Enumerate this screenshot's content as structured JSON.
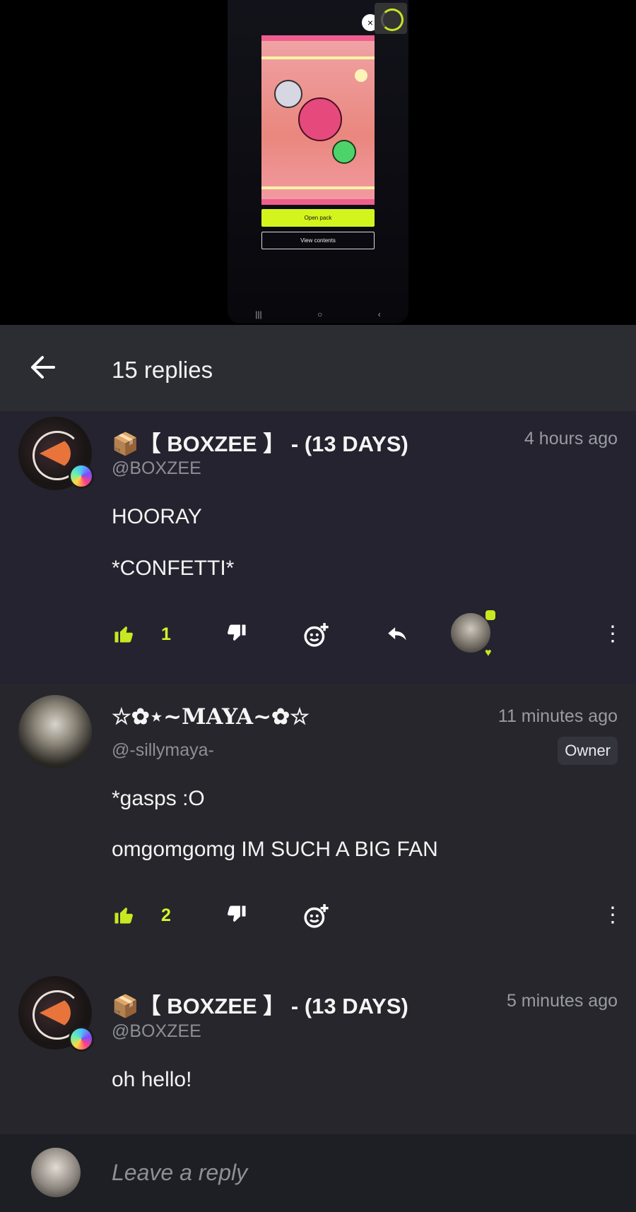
{
  "video": {
    "open_pack": "Open pack",
    "view_contents": "View contents",
    "close_glyph": "×",
    "nav": [
      "|||",
      "○",
      "‹"
    ]
  },
  "header": {
    "back_icon": "arrow-left-icon",
    "title": "15 replies"
  },
  "comments": [
    {
      "name": "📦【 BOXZEE 】 - (13 DAYS)",
      "handle": "@BOXZEE",
      "time": "4 hours ago",
      "lines": [
        "HOORAY",
        "*CONFETTI*"
      ],
      "likes": "1"
    },
    {
      "name": "☆✿⋆~MAYA~✿☆",
      "handle": "@-sillymaya-",
      "time": "11 minutes ago",
      "role": "Owner",
      "lines": [
        "*gasps :O",
        "omgomgomg IM SUCH A BIG FAN"
      ],
      "likes": "2"
    },
    {
      "name": "📦【 BOXZEE 】 - (13 DAYS)",
      "handle": "@BOXZEE",
      "time": "5 minutes ago",
      "lines": [
        "oh hello!"
      ]
    }
  ],
  "compose": {
    "placeholder": "Leave a reply"
  },
  "colors": {
    "accent": "#c8e821",
    "header_bg": "#2b2d33",
    "comment_bg": "#24232f"
  }
}
